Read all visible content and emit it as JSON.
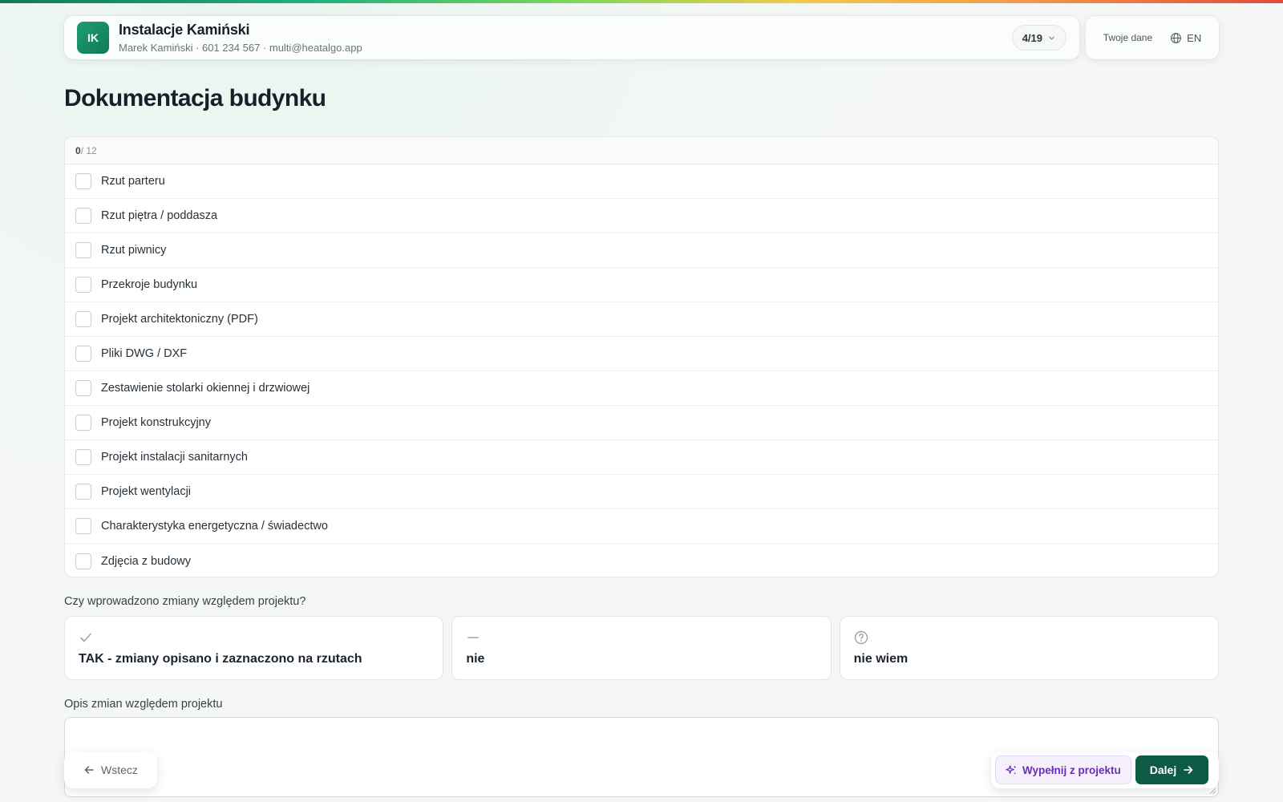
{
  "header": {
    "avatar_initials": "IK",
    "company_name": "Instalacje Kamiński",
    "company_meta": "Marek Kamiński · 601 234 567 · multi@heatalgo.app",
    "step": "4/19"
  },
  "side": {
    "your_data_label": "Twoje dane",
    "language": "EN"
  },
  "page_title": "Dokumentacja budynku",
  "checklist": {
    "checked_count": "0",
    "total": " / 12",
    "items": [
      "Rzut parteru",
      "Rzut piętra / poddasza",
      "Rzut piwnicy",
      "Przekroje budynku",
      "Projekt architektoniczny (PDF)",
      "Pliki DWG / DXF",
      "Zestawienie stolarki okiennej i drzwiowej",
      "Projekt konstrukcyjny",
      "Projekt instalacji sanitarnych",
      "Projekt wentylacji",
      "Charakterystyka energetyczna / świadectwo",
      "Zdjęcia z budowy"
    ]
  },
  "question": {
    "label": "Czy wprowadzono zmiany względem projektu?",
    "options": [
      {
        "icon": "check-icon",
        "text": "TAK - zmiany opisano i zaznaczono na rzutach"
      },
      {
        "icon": "dash-icon",
        "text": "nie"
      },
      {
        "icon": "question-circle-icon",
        "text": "nie wiem"
      }
    ]
  },
  "description": {
    "label": "Opis zmian względem projektu",
    "value": ""
  },
  "footer": {
    "back_label": "Wstecz",
    "fill_label": "Wypełnij z projektu",
    "next_label": "Dalej"
  },
  "colors": {
    "brand": "#0f7a5a",
    "primary_button": "#0e5b45",
    "ai_accent": "#6a2eb0"
  }
}
